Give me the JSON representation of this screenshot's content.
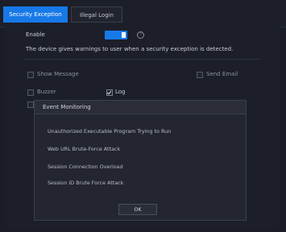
{
  "tabs": [
    {
      "label": "Security Exception",
      "active": true
    },
    {
      "label": "Illegal Login",
      "active": false
    }
  ],
  "settings": {
    "enable_label": "Enable",
    "enable_on": true,
    "description": "The device gives warnings to user when a security exception is detected.",
    "show_message_label": "Show Message",
    "send_email_label": "Send Email",
    "buzzer_label": "Buzzer",
    "log_label": "Log",
    "log_checked": true
  },
  "dialog": {
    "title": "Event Monitoring",
    "events": [
      "Unauthorized Executable Program Trying to Run",
      "Web URL Brute-Force Attack",
      "Session Connection Overload",
      "Session ID Brute Force Attack"
    ],
    "ok_label": "OK"
  },
  "colors": {
    "accent": "#1779e8",
    "background": "#1a1d26",
    "panel": "#1c1f29"
  },
  "icons": {
    "help": "help-circle-icon",
    "check": "checkmark-icon"
  }
}
